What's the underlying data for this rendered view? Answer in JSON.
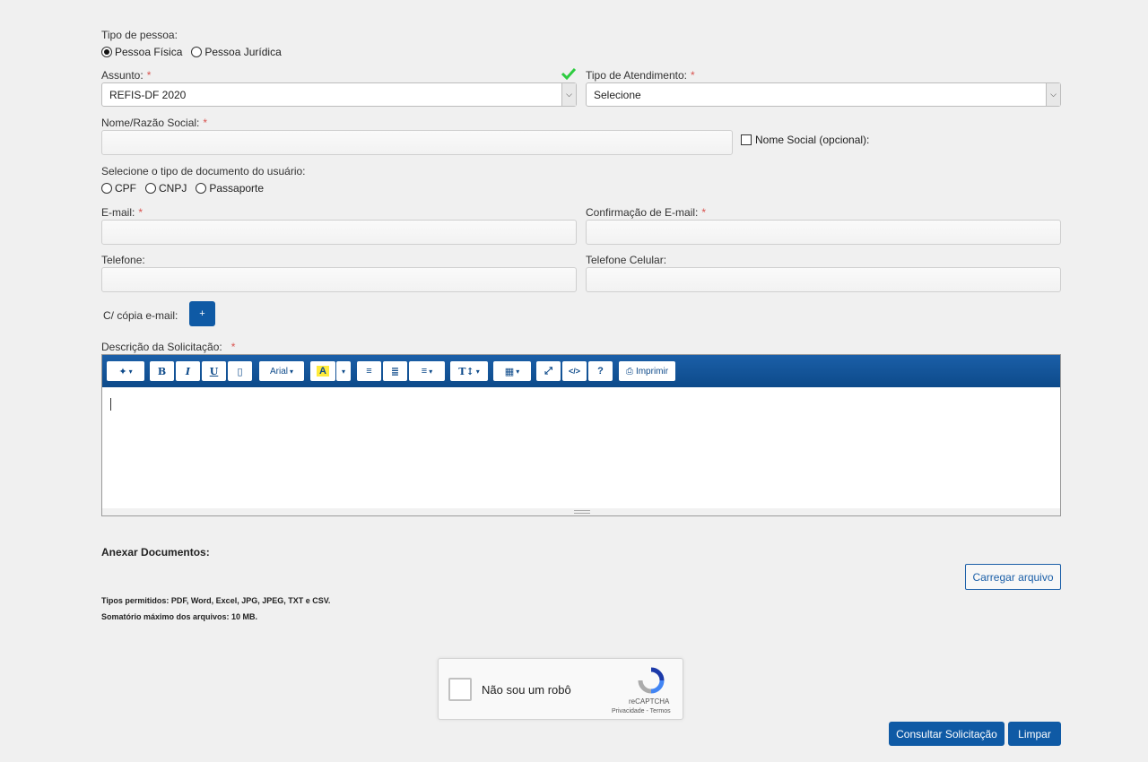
{
  "tipo_pessoa": {
    "label": "Tipo de pessoa:",
    "options": [
      "Pessoa Física",
      "Pessoa Jurídica"
    ],
    "selected": "Pessoa Física"
  },
  "assunto": {
    "label": "Assunto:",
    "required": "*",
    "value": "REFIS-DF 2020"
  },
  "tipo_atendimento": {
    "label": "Tipo de Atendimento:",
    "required": "*",
    "value": "Selecione"
  },
  "nome": {
    "label": "Nome/Razão Social:",
    "required": "*",
    "value": ""
  },
  "nome_social": {
    "label": "Nome Social (opcional):"
  },
  "documento": {
    "label": "Selecione o tipo de documento do usuário:",
    "options": [
      "CPF",
      "CNPJ",
      "Passaporte"
    ]
  },
  "email": {
    "label": "E-mail:",
    "required": "*",
    "value": ""
  },
  "email_confirm": {
    "label": "Confirmação de E-mail:",
    "required": "*",
    "value": ""
  },
  "telefone": {
    "label": "Telefone:",
    "value": ""
  },
  "celular": {
    "label": "Telefone Celular:",
    "value": ""
  },
  "copia": {
    "label": "C/ cópia e-mail:",
    "button": "+"
  },
  "descricao": {
    "label": "Descrição da Solicitação:",
    "required": "*",
    "toolbar": {
      "font": "Arial",
      "print": "Imprimir",
      "bold": "B",
      "italic": "I",
      "underline": "U",
      "help": "?",
      "code": "</>",
      "text_size": "T↕"
    }
  },
  "anexar": {
    "title": "Anexar Documentos:",
    "button": "Carregar arquivo",
    "types": "Tipos permitidos: PDF, Word, Excel, JPG, JPEG, TXT e CSV.",
    "max": "Somatório máximo dos arquivos: 10 MB."
  },
  "captcha": {
    "label": "Não sou um robô",
    "brand": "reCAPTCHA",
    "links": "Privacidade - Termos"
  },
  "actions": {
    "consultar": "Consultar Solicitação",
    "limpar": "Limpar"
  },
  "colors": {
    "accent": "#0f5aa5",
    "required": "#d9534f",
    "valid": "#2ecc40",
    "background": "#f0f0f0"
  }
}
